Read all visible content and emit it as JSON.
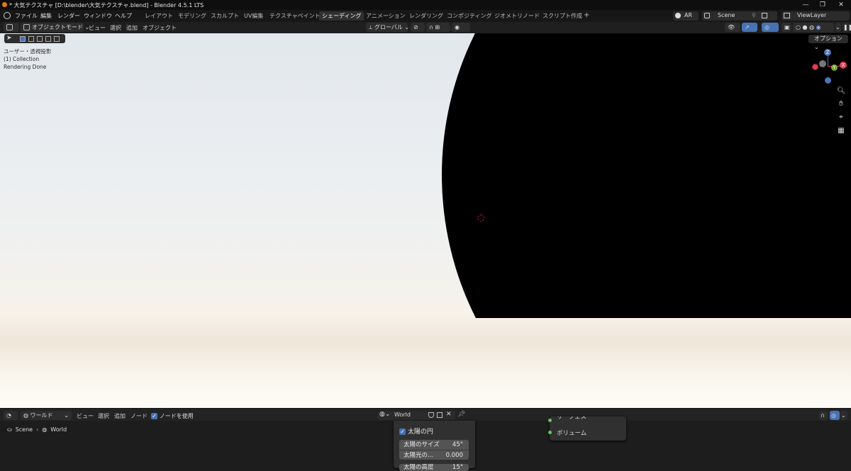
{
  "window": {
    "title": "* 大気テクスチャ [D:\\blender\\大気テクスチャ.blend] - Blender 4.5.1 LTS",
    "controls": [
      "—",
      "❐",
      "✕"
    ]
  },
  "menubar": {
    "items": [
      "ファイル",
      "編集",
      "レンダー",
      "ウィンドウ",
      "ヘルプ"
    ],
    "workspaces": [
      "レイアウト",
      "モデリング",
      "スカルプト",
      "UV編集",
      "テクスチャペイント",
      "シェーディング",
      "アニメーション",
      "レンダリング",
      "コンポジティング",
      "ジオメトリノード",
      "スクリプト作成"
    ],
    "active_workspace": "シェーディング",
    "add_tab": "+",
    "ar_label": "AR",
    "scene_name": "Scene",
    "view_layer": "ViewLayer"
  },
  "viewport_header": {
    "mode": "オブジェクトモード",
    "menus": [
      "ビュー",
      "選択",
      "追加",
      "オブジェクト"
    ],
    "transform_orientation": "グローバル",
    "options_label": "オプション"
  },
  "viewport": {
    "overlay_lines": [
      "ユーザー・透視投影",
      "(1) Collection",
      "Rendering Done"
    ],
    "gizmo_axis_labels": {
      "z": "Z",
      "x": "X",
      "y": "Y"
    },
    "colors": {
      "sun_disc": "#000000",
      "cursor": "#dd2244",
      "x_axis": "#e04050",
      "y_axis": "#7fa830",
      "z_axis": "#4d74b5"
    }
  },
  "node_editor": {
    "editor_type": "ワールド",
    "menus": [
      "ビュー",
      "選択",
      "追加",
      "ノード"
    ],
    "use_nodes_label": "ノードを使用",
    "use_nodes_checked": true,
    "world_name": "World",
    "breadcrumb": [
      "Scene",
      "World"
    ],
    "sun_panel": {
      "checkbox_label": "太陽の円",
      "checked": true,
      "fields": [
        {
          "label": "太陽のサイズ",
          "value": "45°"
        },
        {
          "label": "太陽光の...",
          "value": "0.000"
        },
        {
          "label": "太陽の高度",
          "value": "15°"
        }
      ]
    },
    "output_node": {
      "sockets": [
        "サーフェス",
        "ボリューム"
      ]
    }
  }
}
